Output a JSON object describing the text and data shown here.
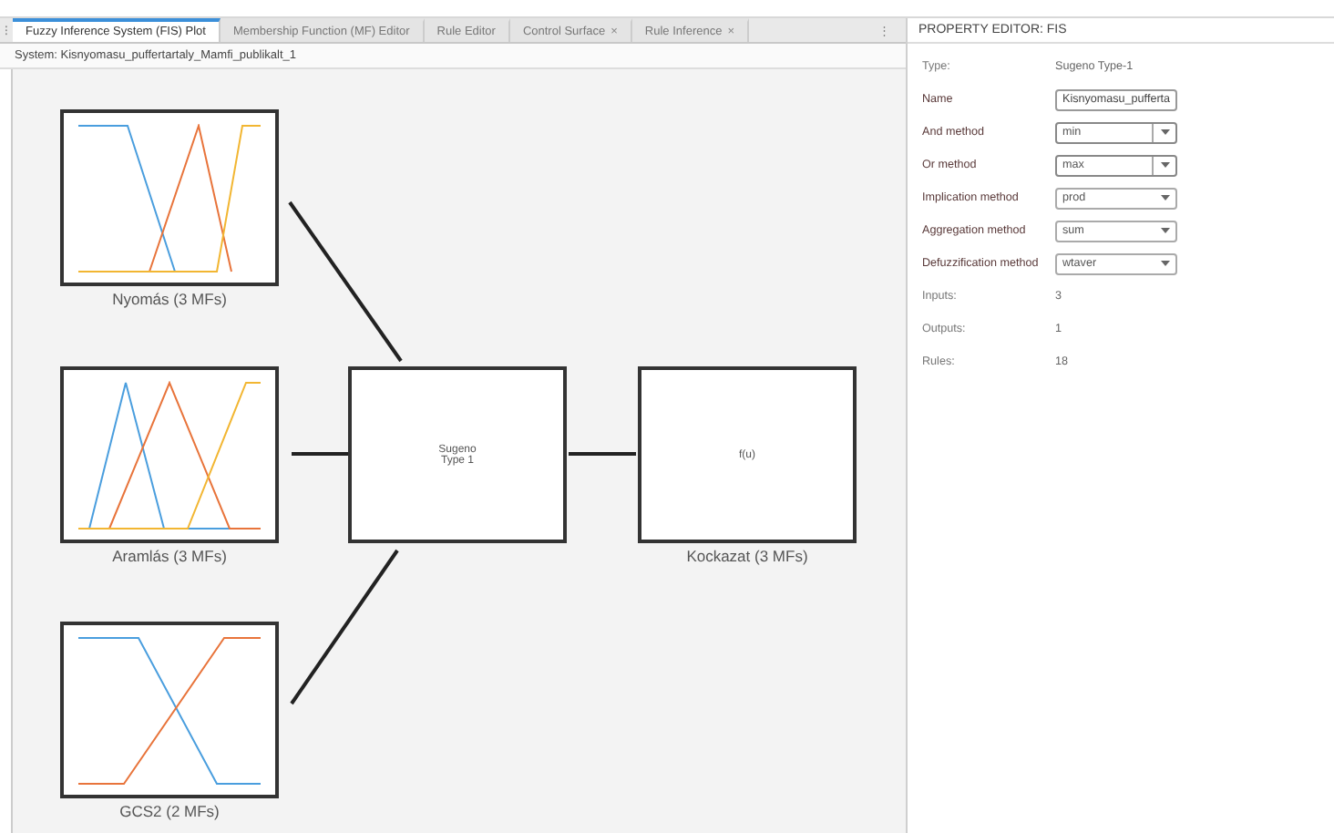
{
  "tabs": [
    {
      "label": "Fuzzy Inference System (FIS) Plot",
      "selected": true,
      "closable": false
    },
    {
      "label": "Membership Function (MF) Editor",
      "selected": false,
      "closable": false
    },
    {
      "label": "Rule Editor",
      "selected": false,
      "closable": false
    },
    {
      "label": "Control Surface",
      "selected": false,
      "closable": true
    },
    {
      "label": "Rule Inference",
      "selected": false,
      "closable": true
    }
  ],
  "close_glyph": "×",
  "menu_glyph": "⋮",
  "grip_glyph": "⁝",
  "system_label": "System: Kisnyomasu_puffertartaly_Mamfi_publikalt_1",
  "inputs": [
    {
      "label": "Nyomás (3 MFs)",
      "mfs": [
        {
          "color": "#4a9ede"
        },
        {
          "color": "#e8743b"
        },
        {
          "color": "#f2b632"
        }
      ]
    },
    {
      "label": "Aramlás (3 MFs)",
      "mfs": [
        {
          "color": "#4a9ede"
        },
        {
          "color": "#e8743b"
        },
        {
          "color": "#f2b632"
        }
      ]
    },
    {
      "label": "GCS2 (2 MFs)",
      "mfs": [
        {
          "color": "#4a9ede"
        },
        {
          "color": "#e8743b"
        }
      ]
    }
  ],
  "system_block": {
    "lines": [
      "Sugeno",
      "Type 1"
    ]
  },
  "output": {
    "function_text": "f(u)",
    "label": "Kockazat (3 MFs)"
  },
  "property_editor": {
    "title": "PROPERTY EDITOR: FIS",
    "rows": [
      {
        "kind": "static",
        "label": "Type:",
        "value": "Sugeno Type-1"
      },
      {
        "kind": "field",
        "label": "Name",
        "value": "Kisnyomasu_pufferta"
      },
      {
        "kind": "combo",
        "label": "And method",
        "value": "min"
      },
      {
        "kind": "combo",
        "label": "Or method",
        "value": "max"
      },
      {
        "kind": "dropdown",
        "label": "Implication method",
        "value": "prod"
      },
      {
        "kind": "dropdown",
        "label": "Aggregation method",
        "value": "sum"
      },
      {
        "kind": "dropdown",
        "label": "Defuzzification method",
        "value": "wtaver"
      },
      {
        "kind": "static",
        "label": "Inputs:",
        "value": "3"
      },
      {
        "kind": "static",
        "label": "Outputs:",
        "value": "1"
      },
      {
        "kind": "static",
        "label": "Rules:",
        "value": "18"
      }
    ]
  }
}
